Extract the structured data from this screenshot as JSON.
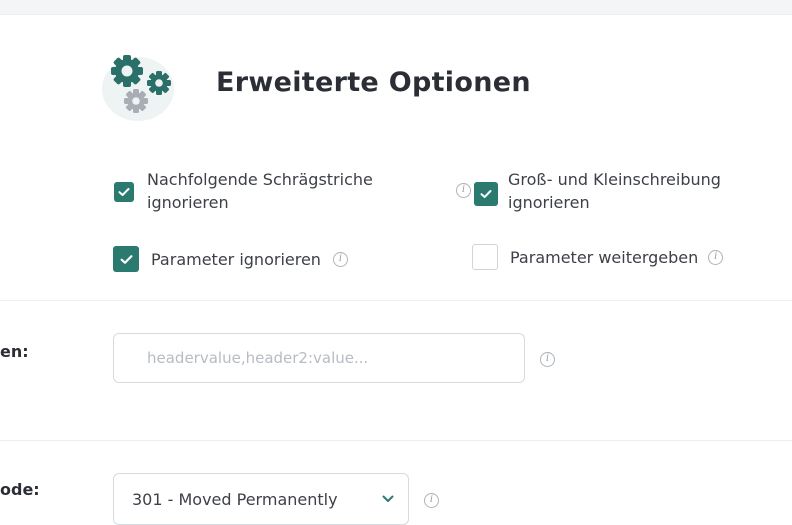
{
  "section": {
    "title": "Erweiterte Optionen",
    "icon": "gears-icon",
    "accent_color": "#2b7a6f"
  },
  "options": [
    {
      "label": "Nachfolgende Schrägstriche ignorieren",
      "checked": true
    },
    {
      "label": "Groß- und Kleinschreibung ignorieren",
      "checked": true
    },
    {
      "label": "Parameter ignorieren",
      "checked": true
    },
    {
      "label": "Parameter weitergeben",
      "checked": false
    }
  ],
  "headers_row": {
    "label": "en:",
    "placeholder": "headervalue,header2:value..."
  },
  "status_row": {
    "label": "ode:",
    "selected": "301 - Moved Permanently"
  },
  "info_glyph": "i"
}
